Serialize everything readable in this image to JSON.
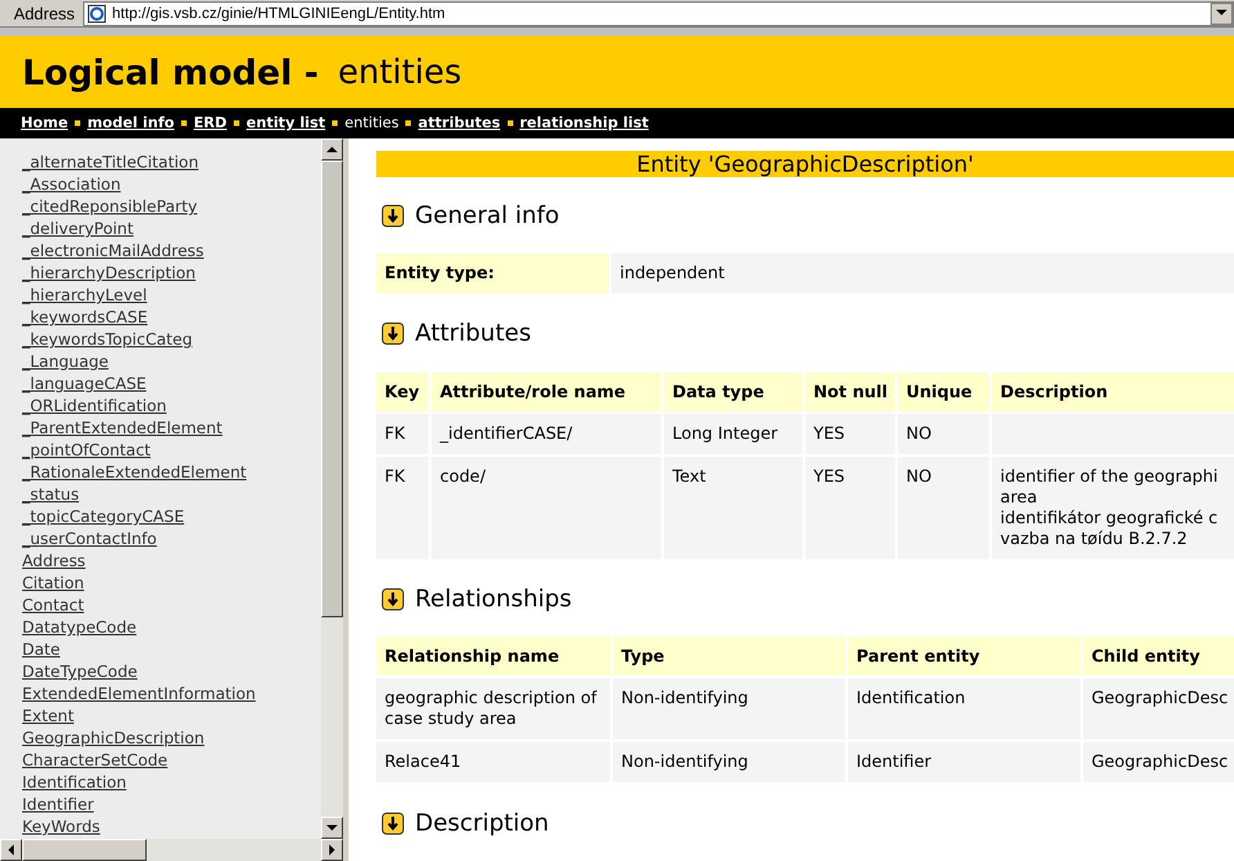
{
  "address_bar": {
    "label": "Address",
    "url": "http://gis.vsb.cz/ginie/HTMLGINIEengL/Entity.htm"
  },
  "header": {
    "title": "Logical model -",
    "subtitle": "entities"
  },
  "nav": [
    {
      "label": "Home",
      "selected": false
    },
    {
      "label": "model info",
      "selected": false
    },
    {
      "label": "ERD",
      "selected": false
    },
    {
      "label": "entity list",
      "selected": false
    },
    {
      "label": "entities",
      "selected": true
    },
    {
      "label": "attributes",
      "selected": false
    },
    {
      "label": "relationship list",
      "selected": false
    }
  ],
  "sidebar": {
    "items": [
      "_alternateTitleCitation",
      "_Association",
      "_citedReponsibleParty",
      "_deliveryPoint",
      "_electronicMailAddress",
      "_hierarchyDescription",
      "_hierarchyLevel",
      "_keywordsCASE",
      "_keywordsTopicCateg",
      "_Language",
      "_languageCASE",
      "_ORLidentification",
      "_ParentExtendedElement",
      "_pointOfContact",
      "_RationaleExtendedElement",
      "_status",
      "_topicCategoryCASE",
      "_userContactInfo",
      "Address",
      "Citation",
      "Contact",
      "DatatypeCode",
      "Date",
      "DateTypeCode",
      "ExtendedElementInformation",
      "Extent",
      "GeographicDescription",
      "CharacterSetCode",
      "Identification",
      "Identifier",
      "KeyWords"
    ]
  },
  "entity_title": "Entity 'GeographicDescription'",
  "general_info": {
    "heading": "General info",
    "label": "Entity type:",
    "value": "independent"
  },
  "attributes": {
    "heading": "Attributes",
    "columns": [
      "Key",
      "Attribute/role name",
      "Data type",
      "Not null",
      "Unique",
      "Description"
    ],
    "rows": [
      [
        "FK",
        "_identifierCASE/",
        "Long Integer",
        "YES",
        "NO",
        ""
      ],
      [
        "FK",
        "code/",
        "Text",
        "YES",
        "NO",
        "identifier of the geographi\narea\nidentifikátor geografické c\nvazba na tøídu B.2.7.2"
      ]
    ]
  },
  "relationships": {
    "heading": "Relationships",
    "columns": [
      "Relationship name",
      "Type",
      "Parent entity",
      "Child entity"
    ],
    "rows": [
      [
        "geographic description of case study area",
        "Non-identifying",
        "Identification",
        "GeographicDesc"
      ],
      [
        "Relace41",
        "Non-identifying",
        "Identifier",
        "GeographicDesc"
      ]
    ]
  },
  "description": {
    "heading": "Description"
  }
}
